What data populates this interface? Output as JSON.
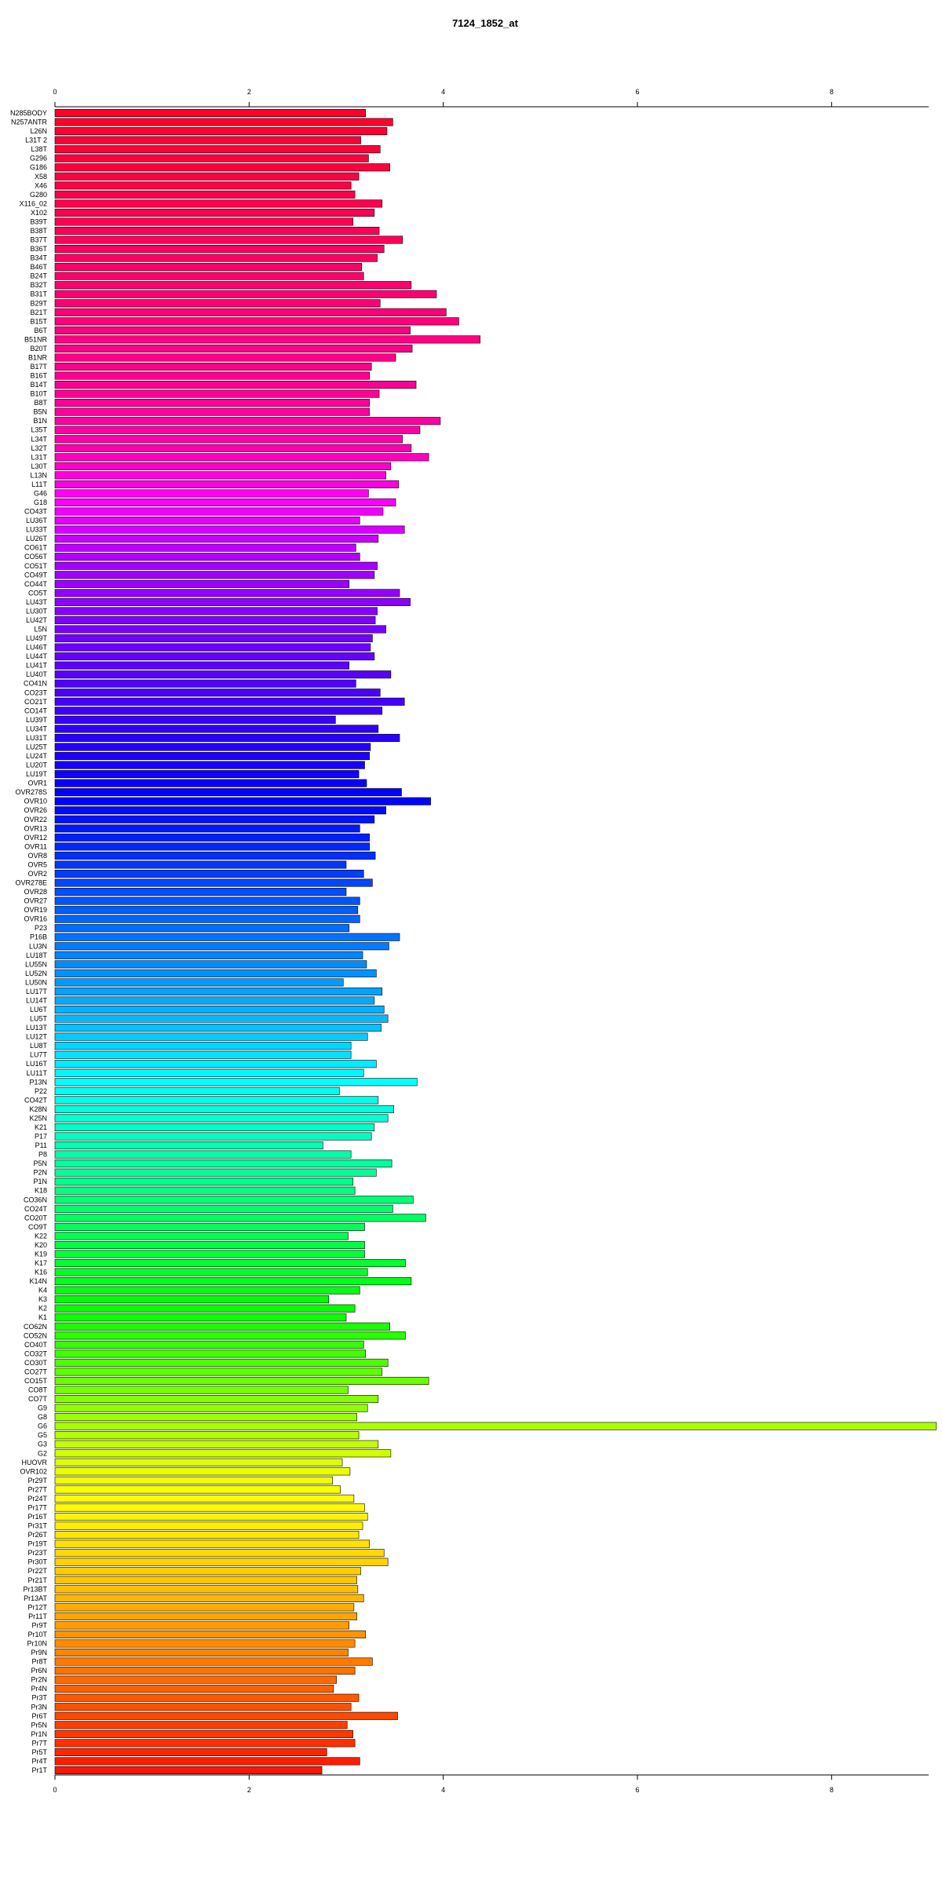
{
  "chart_data": {
    "type": "bar",
    "orientation": "horizontal",
    "title": "7124_1852_at",
    "xlabel": "",
    "ylabel": "",
    "xlim": [
      0,
      9.0
    ],
    "xticks": [
      0,
      2,
      4,
      6,
      8
    ],
    "grid": false,
    "legend": "none",
    "bar_fill": "rainbow gradient from red through magenta, blue, cyan, green, yellow, orange back to red",
    "categories": [
      "N285BODY",
      "N257ANTR",
      "L26N",
      "L31T 2",
      "L38T",
      "G296",
      "G186",
      "X58",
      "X46",
      "G280",
      "X116_02",
      "X102",
      "B39T",
      "B38T",
      "B37T",
      "B36T",
      "B34T",
      "B46T",
      "B24T",
      "B32T",
      "B31T",
      "B29T",
      "B21T",
      "B15T",
      "B6T",
      "B51NR",
      "B20T",
      "B1NR",
      "B17T",
      "B16T",
      "B14T",
      "B10T",
      "B8T",
      "B5N",
      "B1N",
      "L35T",
      "L34T",
      "L32T",
      "L31T",
      "L30T",
      "L13N",
      "L11T",
      "G46",
      "G18",
      "CO43T",
      "LU36T",
      "LU33T",
      "LU26T",
      "CO61T",
      "CO56T",
      "CO51T",
      "CO49T",
      "CO44T",
      "CO5T",
      "LU43T",
      "LU30T",
      "LU42T",
      "L5N",
      "LU49T",
      "LU46T",
      "LU44T",
      "LU41T",
      "LU40T",
      "CO41N",
      "CO23T",
      "CO21T",
      "CO14T",
      "LU39T",
      "LU34T",
      "LU31T",
      "LU25T",
      "LU24T",
      "LU20T",
      "LU19T",
      "OVR1",
      "OVR278S",
      "OVR10",
      "OVR26",
      "OVR22",
      "OVR13",
      "OVR12",
      "OVR11",
      "OVR8",
      "OVR5",
      "OVR2",
      "OVR278E",
      "OVR28",
      "OVR27",
      "OVR19",
      "OVR16",
      "P23",
      "P16B",
      "LU3N",
      "LU18T",
      "LU55N",
      "LU52N",
      "LU50N",
      "LU17T",
      "LU14T",
      "LU6T",
      "LU5T",
      "LU13T",
      "LU12T",
      "LU8T",
      "LU7T",
      "LU16T",
      "LU11T",
      "P13N",
      "P22",
      "CO42T",
      "K28N",
      "K25N",
      "K21",
      "P17",
      "P11",
      "P8",
      "P5N",
      "P2N",
      "P1N",
      "K18",
      "CO36N",
      "CO24T",
      "CO20T",
      "CO9T",
      "K22",
      "K20",
      "K19",
      "K17",
      "K16",
      "K14N",
      "K4",
      "K3",
      "K2",
      "K1",
      "CO62N",
      "CO52N",
      "CO40T",
      "CO32T",
      "CO30T",
      "CO27T",
      "CO15T",
      "CO8T",
      "CO7T",
      "G9",
      "G8",
      "G6",
      "G5",
      "G3",
      "G2",
      "HUOVR",
      "OVR102",
      "Pr29T",
      "Pr27T",
      "Pr24T",
      "Pr17T",
      "Pr16T",
      "Pr31T",
      "Pr26T",
      "Pr19T",
      "Pr23T",
      "Pr30T",
      "Pr22T",
      "Pr21T",
      "Pr13BT",
      "Pr13AT",
      "Pr12T",
      "Pr11T",
      "Pr9T",
      "Pr10T",
      "Pr10N",
      "Pr9N",
      "Pr8T",
      "Pr6N",
      "Pr2N",
      "Pr4N",
      "Pr3T",
      "Pr3N",
      "Pr6T",
      "Pr5N",
      "Pr1N",
      "Pr7T",
      "Pr5T",
      "Pr4T",
      "Pr1T"
    ],
    "values": [
      3.2,
      3.48,
      3.42,
      3.15,
      3.35,
      3.23,
      3.45,
      3.13,
      3.05,
      3.09,
      3.37,
      3.29,
      3.07,
      3.34,
      3.58,
      3.39,
      3.32,
      3.16,
      3.18,
      3.67,
      3.93,
      3.35,
      4.03,
      4.16,
      3.66,
      4.38,
      3.68,
      3.51,
      3.26,
      3.24,
      3.72,
      3.34,
      3.24,
      3.24,
      3.97,
      3.76,
      3.58,
      3.67,
      3.85,
      3.46,
      3.41,
      3.54,
      3.23,
      3.51,
      3.38,
      3.14,
      3.6,
      3.33,
      3.1,
      3.14,
      3.32,
      3.29,
      3.03,
      3.55,
      3.66,
      3.32,
      3.3,
      3.41,
      3.27,
      3.25,
      3.29,
      3.03,
      3.46,
      3.1,
      3.35,
      3.6,
      3.37,
      2.89,
      3.33,
      3.55,
      3.25,
      3.24,
      3.19,
      3.13,
      3.21,
      3.57,
      3.87,
      3.41,
      3.29,
      3.14,
      3.24,
      3.24,
      3.3,
      3.0,
      3.18,
      3.27,
      3.0,
      3.14,
      3.12,
      3.14,
      3.03,
      3.55,
      3.44,
      3.17,
      3.21,
      3.31,
      2.97,
      3.37,
      3.29,
      3.39,
      3.43,
      3.36,
      3.22,
      3.05,
      3.05,
      3.31,
      3.18,
      3.73,
      2.93,
      3.33,
      3.49,
      3.43,
      3.29,
      3.26,
      2.76,
      3.05,
      3.47,
      3.31,
      3.07,
      3.09,
      3.69,
      3.48,
      3.82,
      3.19,
      3.02,
      3.19,
      3.19,
      3.61,
      3.22,
      3.67,
      3.14,
      2.82,
      3.09,
      3.0,
      3.45,
      3.61,
      3.18,
      3.2,
      3.43,
      3.37,
      3.85,
      3.02,
      3.33,
      3.22,
      3.11,
      9.08,
      3.13,
      3.33,
      3.46,
      2.96,
      3.04,
      2.86,
      2.94,
      3.08,
      3.19,
      3.22,
      3.17,
      3.13,
      3.24,
      3.39,
      3.43,
      3.15,
      3.11,
      3.12,
      3.18,
      3.08,
      3.11,
      3.03,
      3.2,
      3.09,
      3.02,
      3.27,
      3.09,
      2.9,
      2.87,
      3.13,
      3.05,
      3.53,
      3.01,
      3.07,
      3.09,
      2.8,
      3.14,
      2.75
    ]
  }
}
